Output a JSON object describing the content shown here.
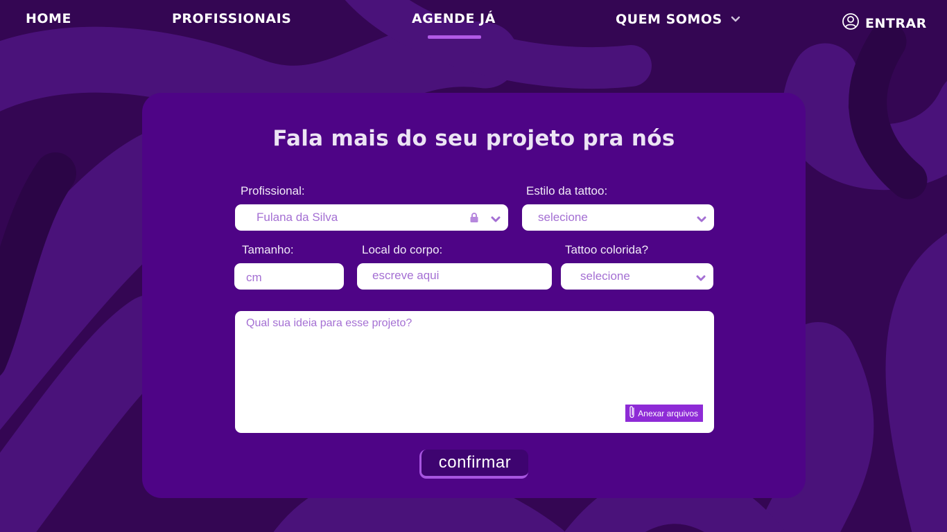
{
  "nav": {
    "home": "HOME",
    "profissionais": "PROFISSIONAIS",
    "agende": "AGENDE JÁ",
    "quem_somos": "QUEM SOMOS",
    "entrar": "ENTRAR",
    "active": "AGENDE JÁ"
  },
  "form": {
    "title": "Fala mais do seu projeto pra nós",
    "profissional": {
      "label": "Profissional:",
      "value": "Fulana da Silva",
      "locked": true
    },
    "estilo": {
      "label": "Estilo da tattoo:",
      "value": "selecione"
    },
    "tamanho": {
      "label": "Tamanho:",
      "placeholder": "cm"
    },
    "local": {
      "label": "Local do corpo:",
      "placeholder": "escreve aqui"
    },
    "colorida": {
      "label": "Tattoo colorida?",
      "value": "selecione"
    },
    "ideia": {
      "placeholder": "Qual sua ideia para esse projeto?"
    },
    "anexar": "Anexar arquivos",
    "confirmar": "confirmar"
  },
  "icons": {
    "user": "user-circle-icon",
    "chevron": "chevron-down-icon",
    "lock": "lock-icon",
    "clip": "paperclip-icon"
  },
  "colors": {
    "background": "#3a0a63",
    "card": "#4e0486",
    "accent": "#b15ae6",
    "field_text": "#a46fd3",
    "attach_button": "#8e2bd6",
    "confirm_button": "#3e0470"
  }
}
